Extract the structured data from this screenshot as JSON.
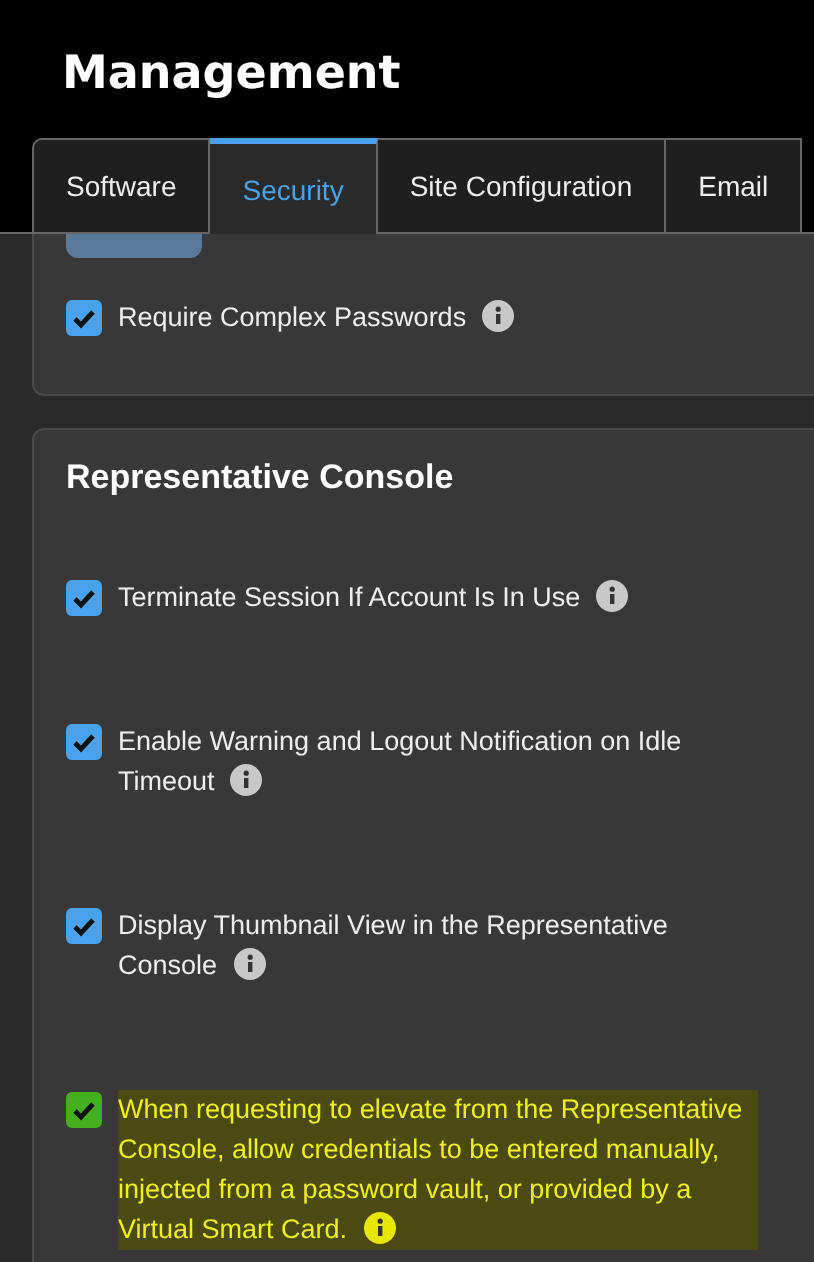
{
  "title": "Management",
  "tabs": [
    {
      "label": "Software",
      "selected": false
    },
    {
      "label": "Security",
      "selected": true
    },
    {
      "label": "Site Configuration",
      "selected": false
    },
    {
      "label": "Email",
      "selected": false
    }
  ],
  "top_card": {
    "options": [
      {
        "label": "Require Complex Passwords",
        "checked": true,
        "highlighted": false
      }
    ]
  },
  "section": {
    "title": "Representative Console",
    "options": [
      {
        "label": "Terminate Session If Account Is In Use",
        "checked": true,
        "highlighted": false
      },
      {
        "label": "Enable Warning and Logout Notification on Idle Timeout",
        "checked": true,
        "highlighted": false
      },
      {
        "label": "Display Thumbnail View in the Representative Console",
        "checked": true,
        "highlighted": false
      },
      {
        "label": "When requesting to elevate from the Representative Console, allow credentials to be entered manually, injected from a password vault, or provided by a Virtual Smart Card.",
        "checked": true,
        "highlighted": true
      }
    ]
  }
}
